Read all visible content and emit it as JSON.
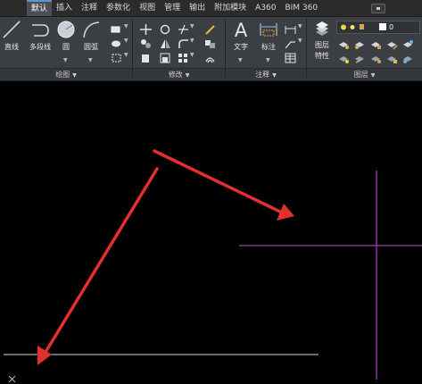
{
  "ribbon_tabs": [
    "默认",
    "插入",
    "注释",
    "参数化",
    "视图",
    "管理",
    "输出",
    "附加模块",
    "A360",
    "BIM 360"
  ],
  "draw_panel": {
    "title": "绘图",
    "tools": {
      "line": "直线",
      "polyline": "多段线",
      "circle": "圆",
      "arc": "圆弧"
    }
  },
  "modify_panel": {
    "title": "修改"
  },
  "annotation_panel": {
    "title": "注释",
    "tools": {
      "text": "文字",
      "dimension": "标注"
    }
  },
  "layers_panel": {
    "title": "图层",
    "tools": {
      "layer_properties_line1": "图层",
      "layer_properties_line2": "特性"
    },
    "current_layer": "0"
  },
  "colors": {
    "ribbon_bg": "#3b3e43",
    "canvas_bg": "#000000",
    "crosshair": "#a23bb5",
    "arrow": "#e32f2f",
    "drawn_line": "#d9d9d9"
  }
}
